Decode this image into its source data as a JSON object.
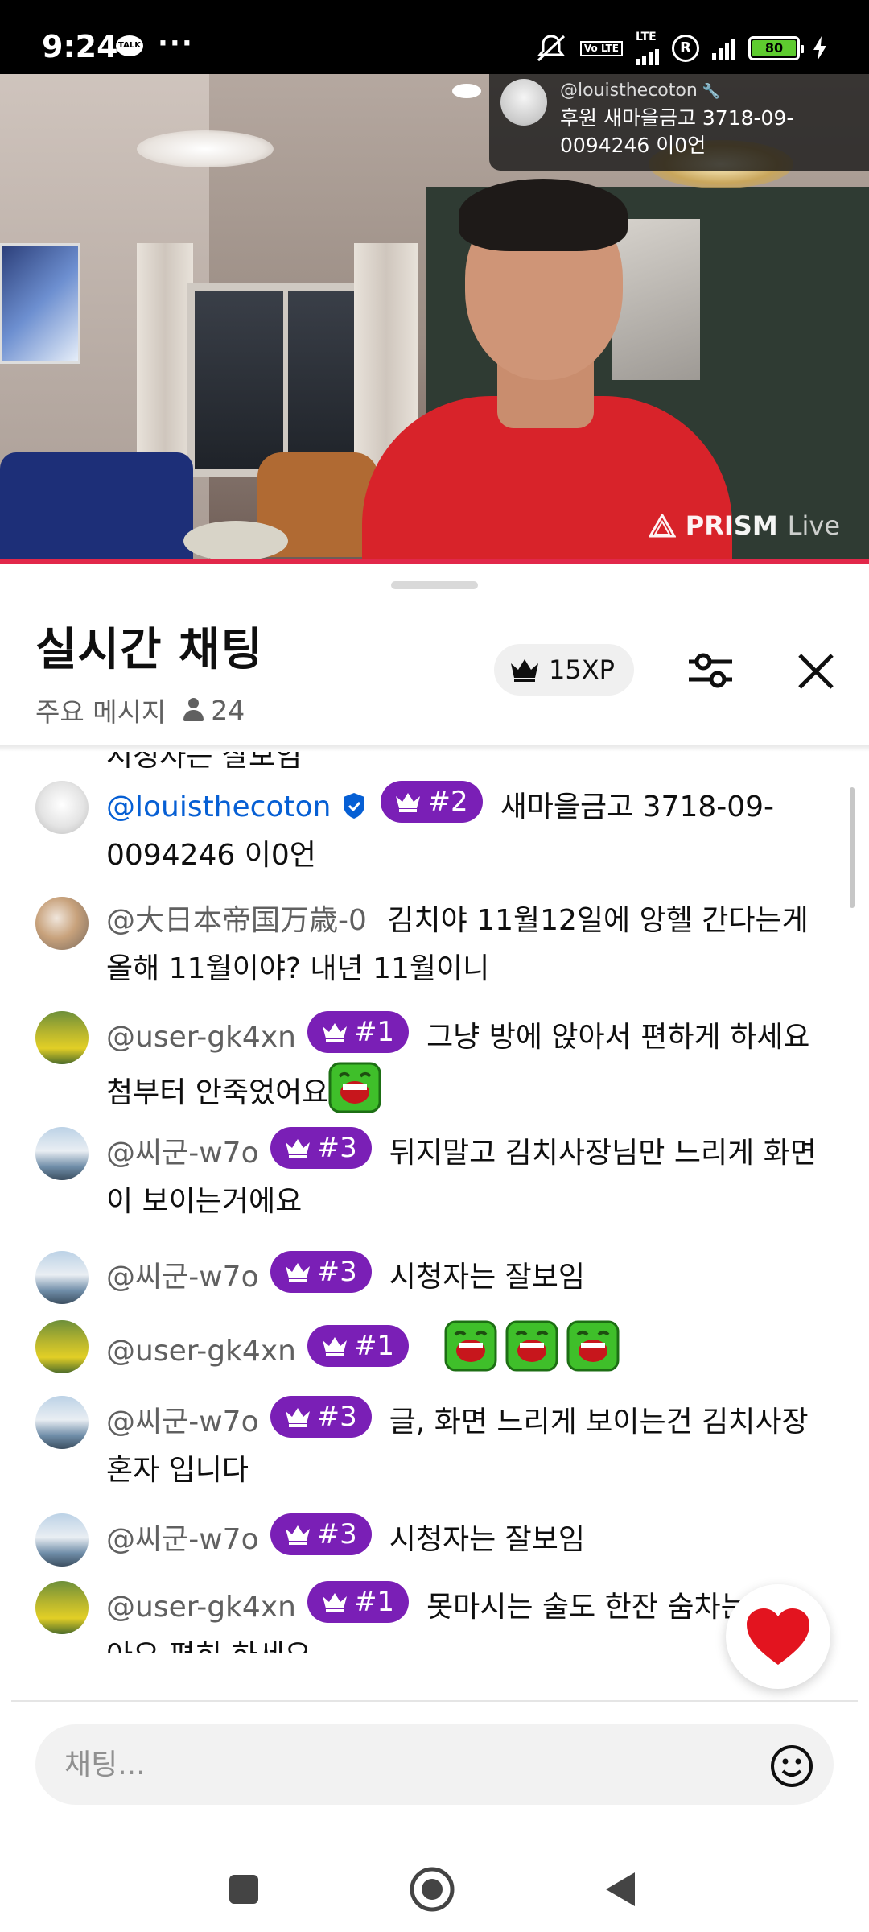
{
  "status_bar": {
    "time": "9:24",
    "talk_icon_text": "TALK",
    "more": "···",
    "volte": "Vo LTE",
    "lte": "LTE",
    "r_badge": "R",
    "battery": "80"
  },
  "video": {
    "watermark": "PRISM",
    "watermark_live": "Live",
    "donation": {
      "user": "@louisthecoton",
      "message": "후원 새마을금고 3718-09-0094246 이0언"
    }
  },
  "chat": {
    "title": "실시간 채팅",
    "filter_label": "주요 메시지",
    "viewer_count": "24",
    "xp": "15XP",
    "cut_text": "시청자는 잘보임",
    "messages": [
      {
        "author": "@louisthecoton",
        "owner": true,
        "badge": "#2",
        "text": "새마을금고 3718-09-0094246 이0언",
        "avatar": "bear"
      },
      {
        "author": "@大日本帝国万歳-0",
        "text": "김치야 11월12일에 앙헬 간다는게 올해 11월이야? 내년 11월이니",
        "avatar": "flowers"
      },
      {
        "author": "@user-gk4xn",
        "badge": "#1",
        "text": "그냥 방에 앉아서 편하게 하세요 첨부터 안죽었어요",
        "emoji_count": 1,
        "avatar": "field"
      },
      {
        "author": "@씨군-w7o",
        "badge": "#3",
        "text": "뒤지말고 김치사장님만 느리게 화면이 보이는거에요",
        "avatar": "sea"
      },
      {
        "author": "@씨군-w7o",
        "badge": "#3",
        "text": "시청자는 잘보임",
        "avatar": "sea"
      },
      {
        "author": "@user-gk4xn",
        "badge": "#1",
        "text": "",
        "emoji_count": 3,
        "avatar": "field"
      },
      {
        "author": "@씨군-w7o",
        "badge": "#3",
        "text": "글, 화면 느리게 보이는건 김치사장 혼자 입니다",
        "avatar": "sea"
      },
      {
        "author": "@씨군-w7o",
        "badge": "#3",
        "text": "시청자는 잘보임",
        "avatar": "sea"
      },
      {
        "author": "@user-gk4xn",
        "badge": "#1",
        "text": "못마시는 술도 한잔 숨차는거 같아요 편히 하세요",
        "avatar": "field"
      }
    ],
    "input_placeholder": "채팅..."
  }
}
